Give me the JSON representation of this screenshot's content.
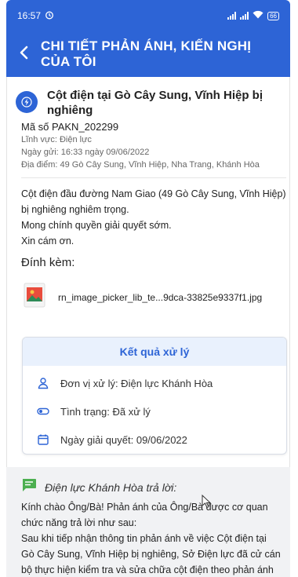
{
  "status_bar": {
    "time": "16:57",
    "battery": "66"
  },
  "header": {
    "back_icon": "chevron-left-icon",
    "title": "CHI TIẾT PHẢN ÁNH, KIẾN NGHỊ CỦA TÔI"
  },
  "report": {
    "title": "Cột điện tại Gò Cây Sung, Vĩnh Hiệp bị nghiêng",
    "code": "Mã số PAKN_202299",
    "field": "Lĩnh vực: Điện lực",
    "sent_date": "Ngày gửi: 16:33 ngày 09/06/2022",
    "location": "Địa điểm: 49 Gò Cây Sung, Vĩnh Hiệp, Nha Trang, Khánh Hòa",
    "content_lines": [
      "Cột điện đầu đường Nam Giao (49 Gò Cây Sung, Vĩnh Hiệp)",
      "bị nghiêng nghiêm trọng.",
      "Mong chính quyền giải quyết sớm.",
      "Xin cám ơn."
    ],
    "attachment_label": "Đính kèm:",
    "attachment_file": "rn_image_picker_lib_te...9dca-33825e9337f1.jpg"
  },
  "result": {
    "heading": "Kết quả xử lý",
    "unit": "Đơn vị xử lý: Điện lực Khánh Hòa",
    "status": "Tình trạng: Đã xử lý",
    "resolved_date": "Ngày giải quyết: 09/06/2022"
  },
  "reply": {
    "title": "Điện lực Khánh Hòa trả lời:",
    "lines": [
      "Kính chào Ông/Bà! Phản ánh của Ông/Bà được cơ quan",
      "chức năng trả lời như sau:",
      "Sau khi tiếp nhận thông tin phản ánh về việc Cột điện tại",
      "Gò Cây Sung, Vĩnh Hiệp bị nghiêng, Sở Điện lực đã cử cán",
      "bộ thực hiện kiểm tra và sửa chữa cột điện theo phản ánh"
    ]
  },
  "colors": {
    "primary": "#2d64d6",
    "card_head": "#e9f1fd",
    "reply_bg": "#f1f2f4",
    "reply_icon": "#4caf50"
  }
}
